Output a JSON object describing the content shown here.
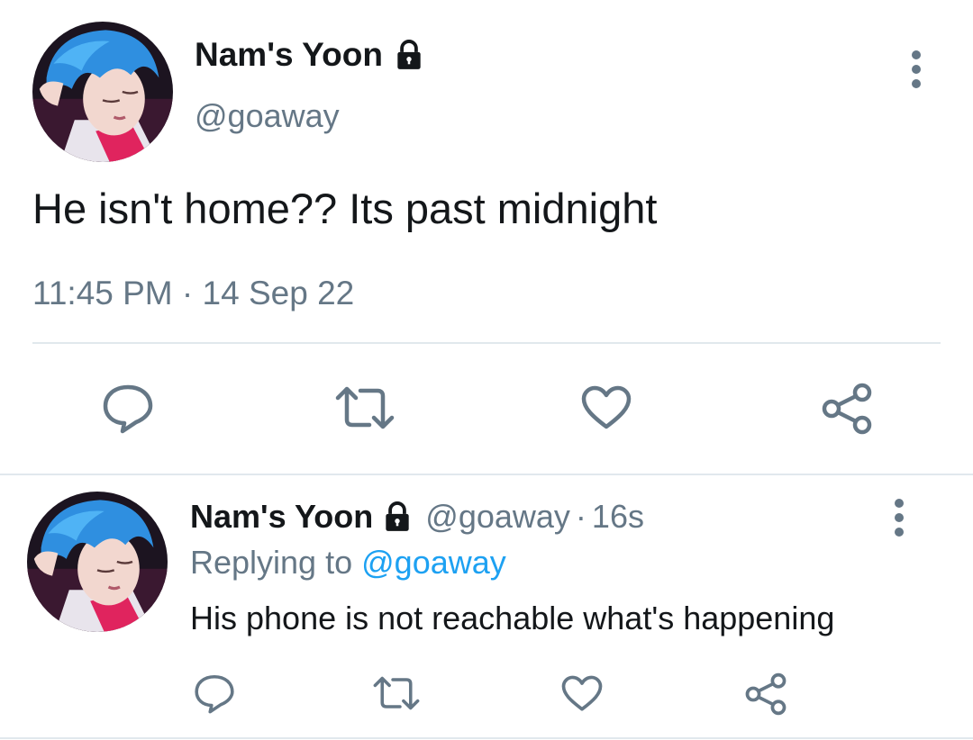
{
  "main_tweet": {
    "author_name": "Nam's Yoon",
    "handle": "@goaway",
    "text": "He isn't home?? Its past midnight",
    "time": "11:45 PM",
    "separator": "·",
    "date": "14 Sep 22",
    "protected_icon": "lock-icon",
    "more_icon": "more-vertical-icon",
    "actions": [
      {
        "icon": "reply-icon"
      },
      {
        "icon": "retweet-icon"
      },
      {
        "icon": "like-icon"
      },
      {
        "icon": "share-icon"
      }
    ]
  },
  "reply_tweet": {
    "author_name": "Nam's Yoon",
    "handle": "@goaway",
    "separator": "·",
    "time_ago": "16s",
    "replying_prefix": "Replying to",
    "replying_to": "@goaway",
    "text": "His phone is not reachable what's happening",
    "protected_icon": "lock-icon",
    "more_icon": "more-vertical-icon",
    "actions": [
      {
        "icon": "reply-icon"
      },
      {
        "icon": "retweet-icon"
      },
      {
        "icon": "like-icon"
      },
      {
        "icon": "share-icon"
      }
    ]
  },
  "colors": {
    "text_primary": "#14171a",
    "text_secondary": "#657786",
    "link": "#1da1f2",
    "divider": "#e1e8ed",
    "icon": "#657786"
  }
}
